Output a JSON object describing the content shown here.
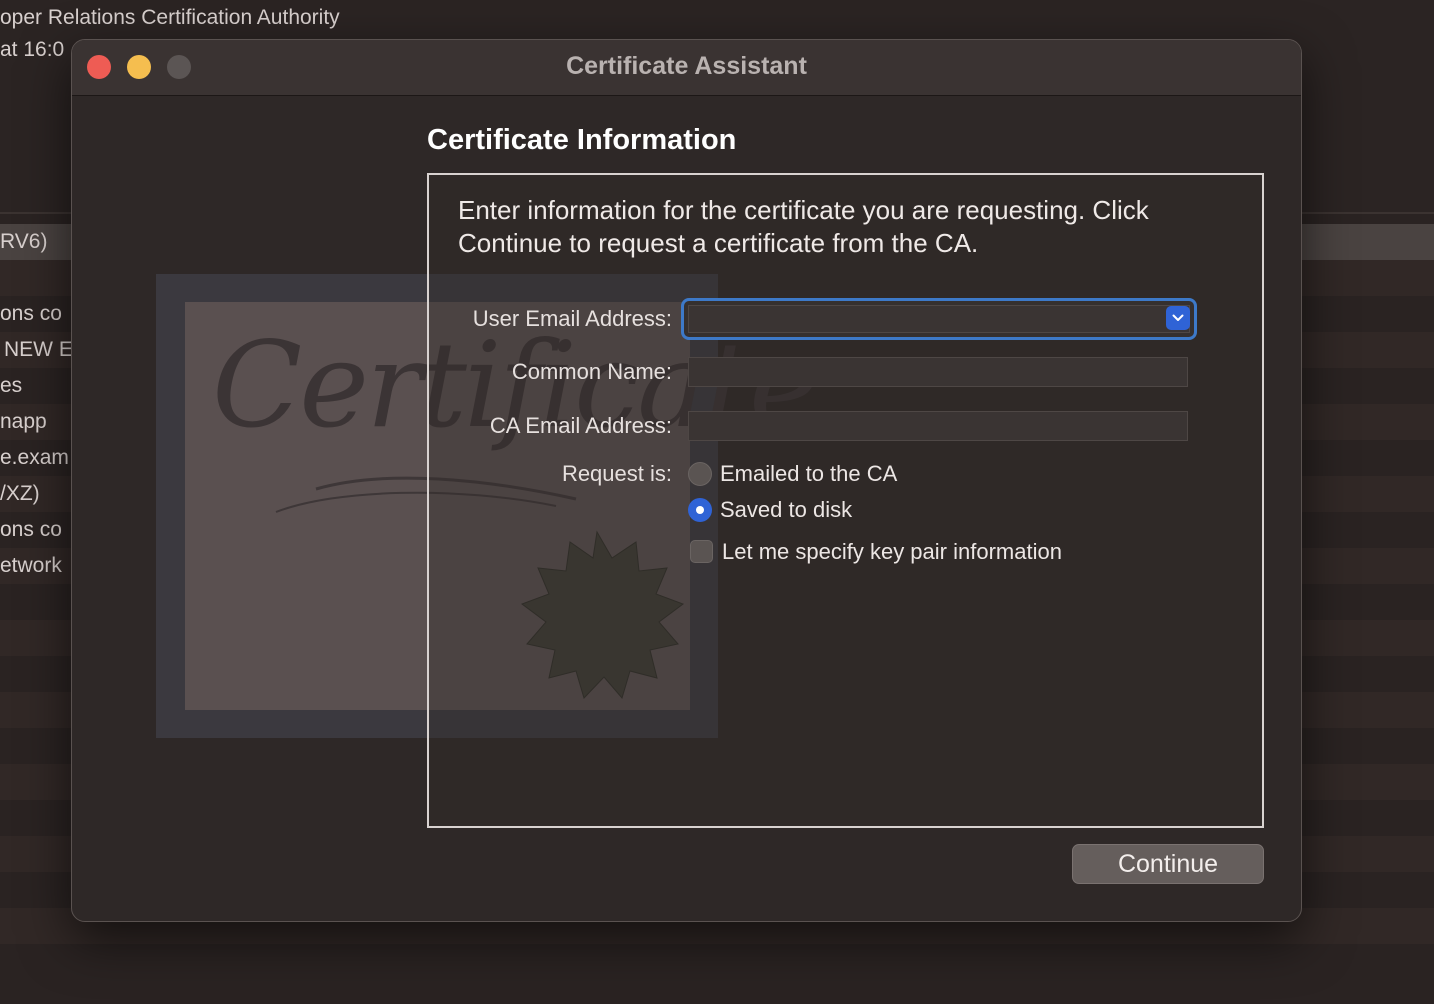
{
  "background": {
    "top_lines": [
      "oper Relations Certification Authority",
      "at 16:0"
    ],
    "rows": [
      {
        "text": "RV6)",
        "state": "sel"
      },
      {
        "text": "",
        "state": "alt"
      },
      {
        "text": "ons co",
        "state": ""
      },
      {
        "text": "NEW E",
        "state": "alt"
      },
      {
        "text": "es",
        "state": ""
      },
      {
        "text": "napp",
        "state": "alt"
      },
      {
        "text": "e.exam",
        "state": ""
      },
      {
        "text": "/XZ)",
        "state": "alt"
      },
      {
        "text": "ons co",
        "state": ""
      },
      {
        "text": "etwork",
        "state": "alt"
      }
    ]
  },
  "window": {
    "title": "Certificate Assistant"
  },
  "form": {
    "section_title": "Certificate Information",
    "intro": "Enter information for the certificate you are requesting. Click Continue to request a certificate from the CA.",
    "user_email_label": "User Email Address:",
    "user_email_value": "",
    "common_name_label": "Common Name:",
    "common_name_value": "",
    "ca_email_label": "CA Email Address:",
    "ca_email_value": "",
    "request_label": "Request is:",
    "option_emailed": "Emailed to the CA",
    "option_saved": "Saved to disk",
    "selected_option": "Saved to disk",
    "key_pair_label": "Let me specify key pair information",
    "key_pair_checked": false,
    "artwork_text": "Certificate"
  },
  "buttons": {
    "continue": "Continue"
  },
  "colors": {
    "accent": "#2f63d6",
    "focus_ring": "#3d79c8",
    "close": "#ee5c54",
    "minimize": "#f5be4f"
  }
}
